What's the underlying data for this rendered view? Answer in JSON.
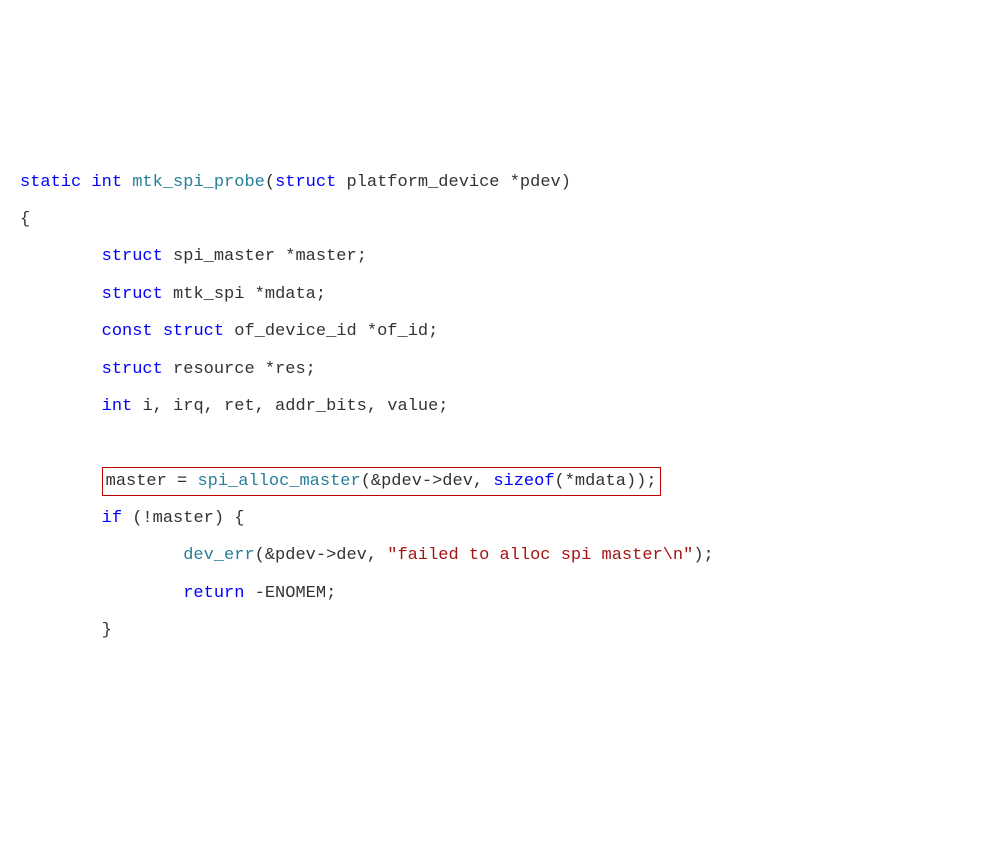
{
  "code": {
    "l1": {
      "kw1": "static",
      "kw2": "int",
      "fn": "mtk_spi_probe",
      "p1": "(",
      "kw3": "struct",
      "ty": "platform_device",
      "ptr": "*pdev",
      "p2": ")"
    },
    "l2": "{",
    "l3": {
      "kw": "struct",
      "ty": "spi_master",
      "ptr": "*master;"
    },
    "l4": {
      "kw": "struct",
      "ty": "mtk_spi",
      "ptr": "*mdata;"
    },
    "l5": {
      "kw1": "const",
      "kw2": "struct",
      "ty": "of_device_id",
      "ptr": "*of_id;"
    },
    "l6": {
      "kw": "struct",
      "ty": "resource",
      "ptr": "*res;"
    },
    "l7": {
      "kw": "int",
      "vars": "i, irq, ret, addr_bits, value;"
    },
    "l8": {
      "lhs": "master = ",
      "fn": "spi_alloc_master",
      "arg1": "(&pdev->dev, ",
      "szof": "sizeof",
      "arg2": "(*mdata));"
    },
    "l9": {
      "kw": "if",
      "cond": "(!master) {"
    },
    "l10": {
      "fn": "dev_err",
      "args": "(&pdev->dev, ",
      "str": "\"failed to alloc spi master\\n\"",
      "end": ");"
    },
    "l11": {
      "kw": "return",
      "val": " -ENOMEM;"
    },
    "l12": "        }"
  }
}
